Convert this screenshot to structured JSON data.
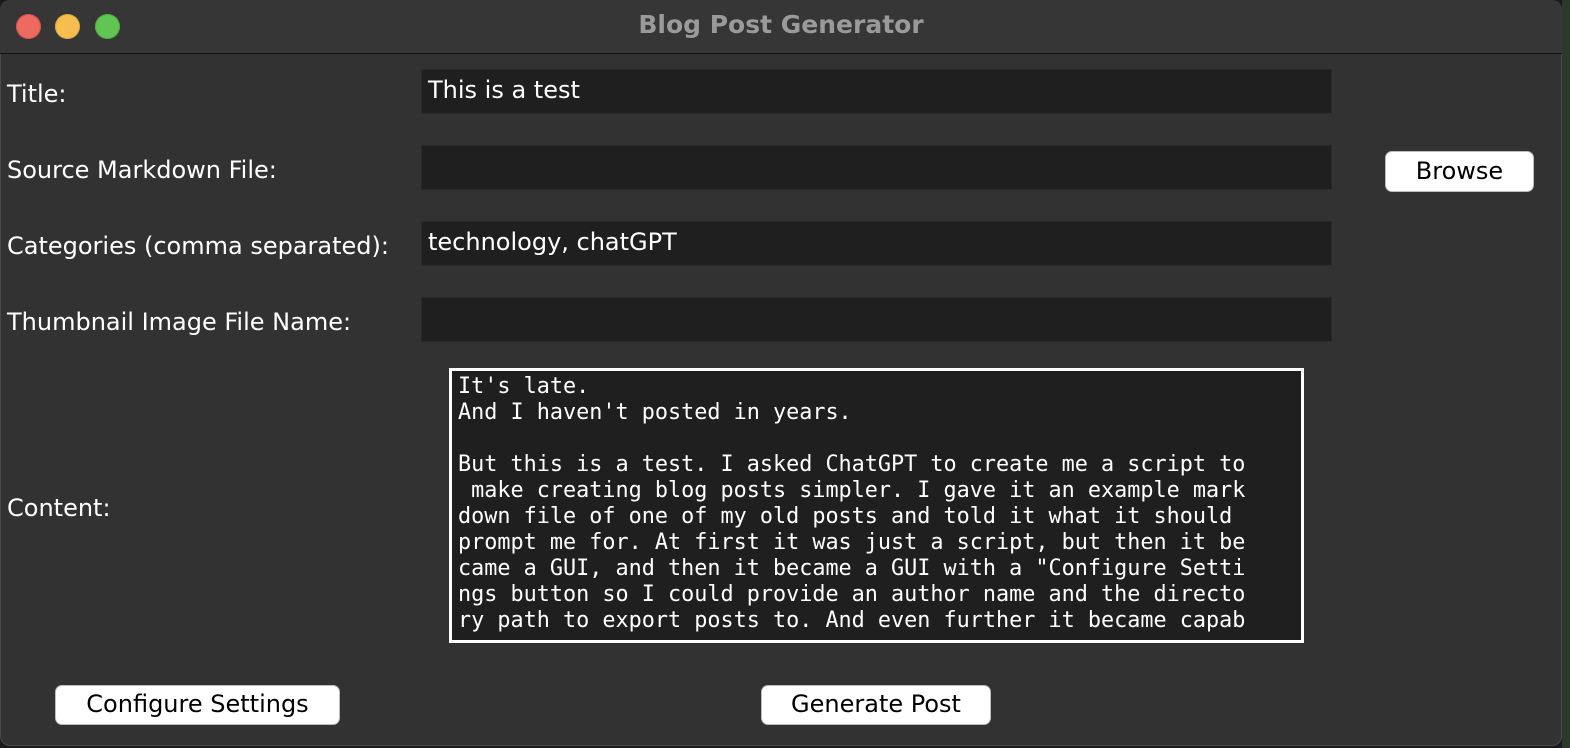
{
  "window": {
    "title": "Blog Post Generator",
    "buttons": [
      "close",
      "minimize",
      "zoom"
    ]
  },
  "form": {
    "title_label": "Title:",
    "title_value": "This is a test",
    "source_label": "Source Markdown File:",
    "source_value": "",
    "browse_label": "Browse",
    "categories_label": "Categories (comma separated):",
    "categories_value": "technology, chatGPT",
    "thumbnail_label": "Thumbnail Image File Name:",
    "thumbnail_value": "",
    "content_label": "Content:",
    "content_lines": [
      "It's late.",
      "And I haven't posted in years.",
      "",
      "But this is a test. I asked ChatGPT to create me a script to",
      " make creating blog posts simpler. I gave it an example mark",
      "down file of one of my old posts and told it what it should ",
      "prompt me for. At first it was just a script, but then it be",
      "came a GUI, and then it became a GUI with a \"Configure Setti",
      "ngs button so I could provide an author name and the directo",
      "ry path to export posts to. And even further it became capab"
    ]
  },
  "actions": {
    "configure_label": "Configure Settings",
    "generate_label": "Generate Post"
  },
  "colors": {
    "window_bg": "#323232",
    "field_bg": "#1f1f1f",
    "text": "#ffffff",
    "button_bg": "#ffffff"
  }
}
